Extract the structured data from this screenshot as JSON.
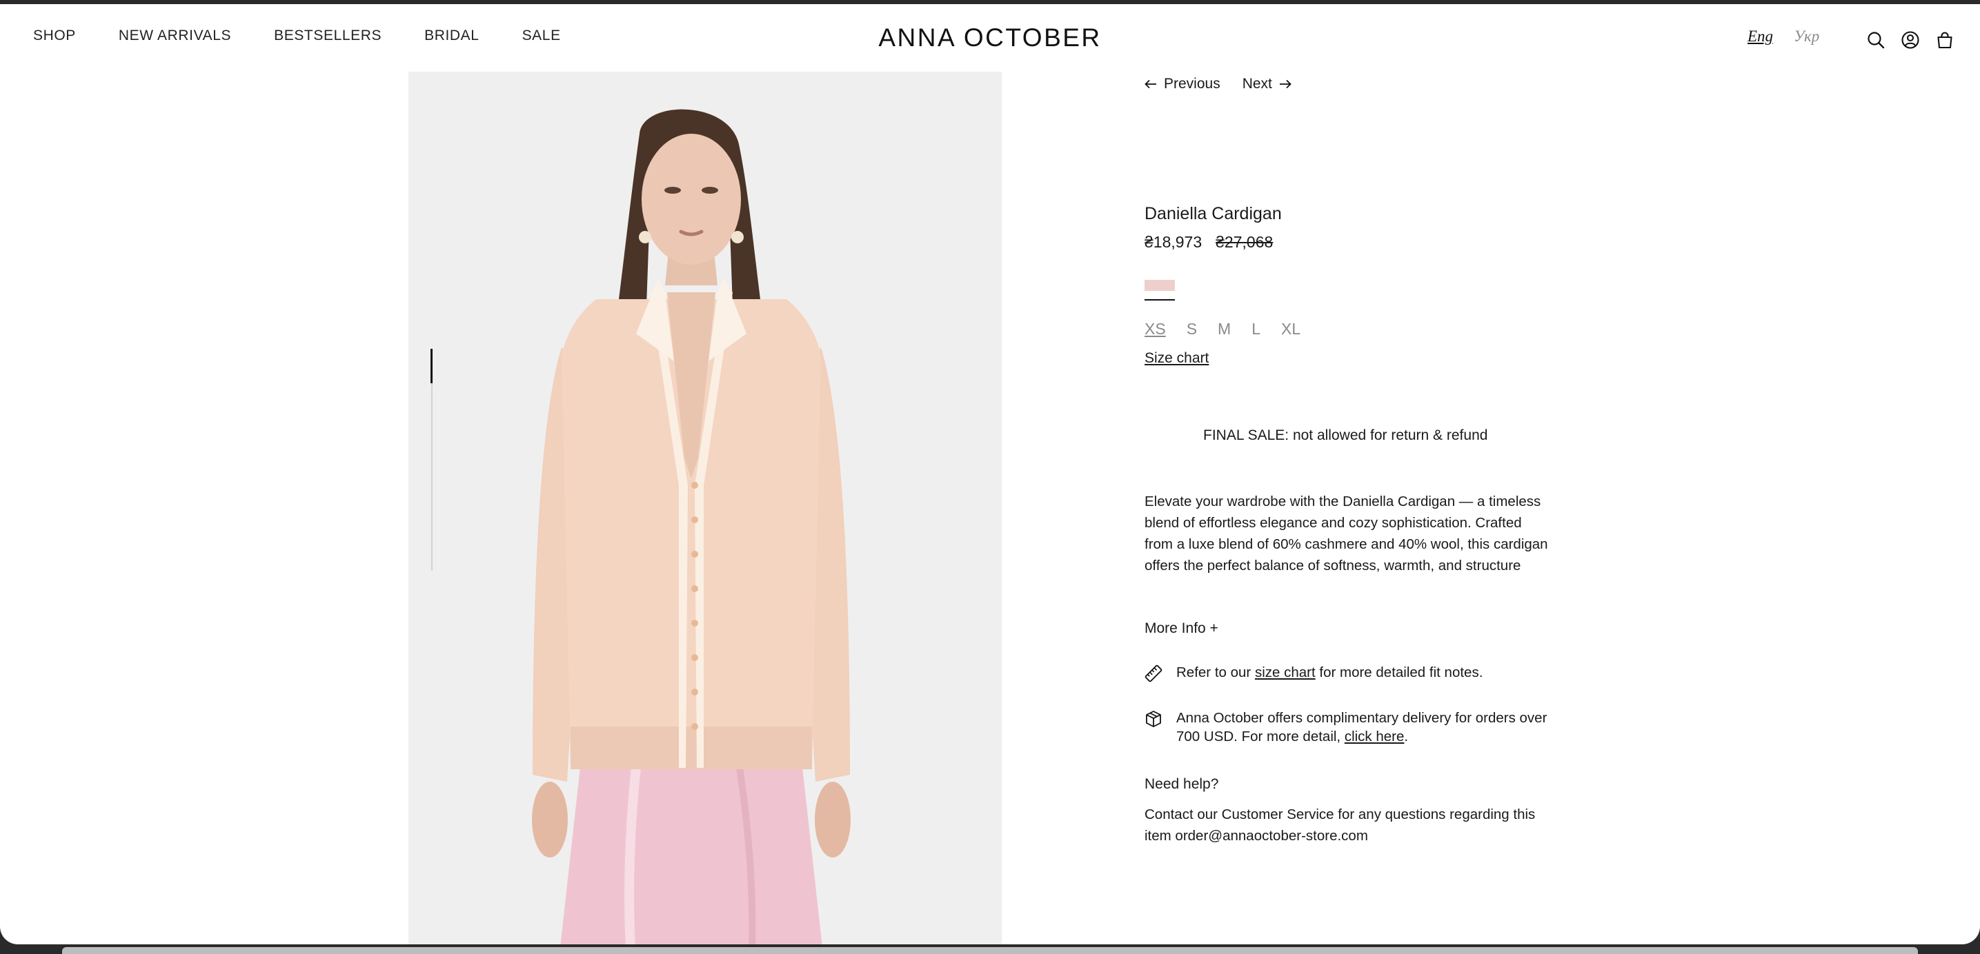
{
  "header": {
    "nav": [
      "SHOP",
      "NEW ARRIVALS",
      "BESTSELLERS",
      "BRIDAL",
      "SALE"
    ],
    "logo": "ANNA OCTOBER",
    "lang_active": "Eng",
    "lang_inactive": "Укр",
    "icons": [
      "search-icon",
      "account-icon",
      "bag-icon"
    ]
  },
  "product": {
    "prev_label": "Previous",
    "next_label": "Next",
    "name": "Daniella Cardigan",
    "price": "₴18,973",
    "old_price": "₴27,068",
    "swatch_color": "#eecfcc",
    "sizes": [
      "XS",
      "S",
      "M",
      "L",
      "XL"
    ],
    "size_chart_label": "Size chart",
    "final_sale": "FINAL SALE: not allowed for return & refund",
    "description": "Elevate your wardrobe with the Daniella Cardigan — a timeless blend of effortless elegance and cozy sophistication. Crafted from a luxe blend of 60% cashmere and 40% wool, this cardigan offers the perfect balance of softness, warmth, and structure",
    "more_info": "More Info +",
    "fit_prefix": "Refer to our ",
    "fit_link": "size chart",
    "fit_suffix": " for more detailed fit notes.",
    "delivery_prefix": "Anna October offers complimentary delivery for orders over 700 USD. For more detail, ",
    "delivery_link": "click here",
    "delivery_suffix": ".",
    "help_title": "Need help?",
    "help_text": "Contact our Customer Service for any questions regarding this item order@annaoctober-store.com"
  },
  "gallery": {
    "image_icon": "product-photo",
    "progress_fraction": 0.16
  }
}
